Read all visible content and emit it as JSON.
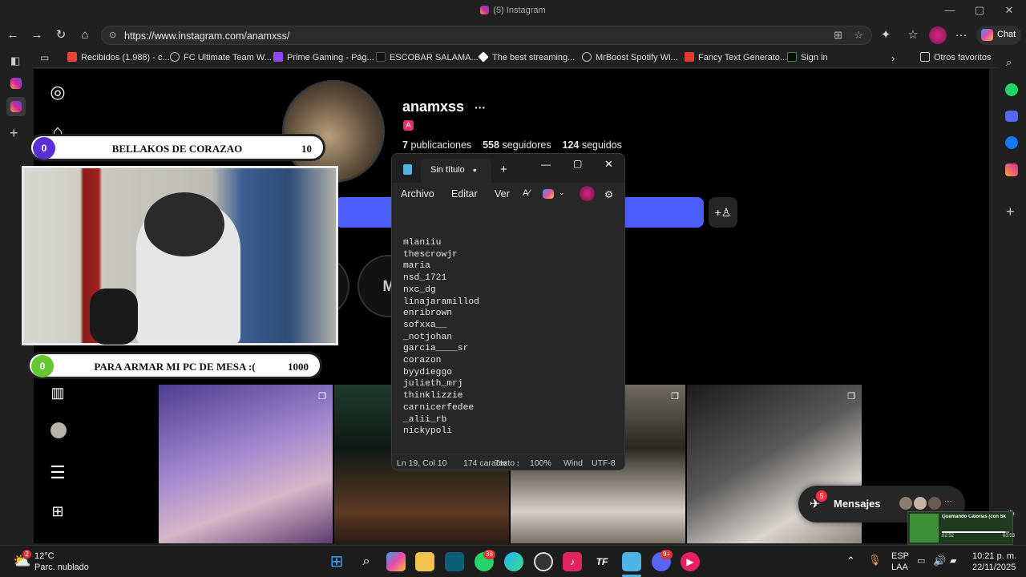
{
  "browser": {
    "title": "(5) Instagram",
    "url": "https://www.instagram.com/anamxss/",
    "chat_label": "Chat",
    "bookmarks": [
      {
        "label": "Recibidos (1.988) - c..."
      },
      {
        "label": "FC Ultimate Team W..."
      },
      {
        "label": "Prime Gaming - Pág..."
      },
      {
        "label": "ESCOBAR SALAMA..."
      },
      {
        "label": "The best streaming..."
      },
      {
        "label": "MrBoost Spotify Wi..."
      },
      {
        "label": "Fancy Text Generato..."
      },
      {
        "label": "Sign in"
      }
    ],
    "other_favorites": "Otros favoritos"
  },
  "profile": {
    "username": "anamxss",
    "badge": "A",
    "posts_count": "7",
    "posts_label": "publicaciones",
    "followers_count": "558",
    "followers_label": "seguidores",
    "following_count": "124",
    "following_label": "seguidos",
    "highlight_text": "M"
  },
  "overlay": {
    "top": {
      "count": "0",
      "label": "BELLAKOS DE CORAZAO",
      "goal": "10"
    },
    "bottom": {
      "count": "0",
      "label": "PARA ARMAR MI PC DE MESA :(",
      "goal": "1000"
    }
  },
  "notepad": {
    "tab_title": "Sin título",
    "menu": {
      "file": "Archivo",
      "edit": "Editar",
      "view": "Ver"
    },
    "lines": [
      "mlaniiu",
      "thescrowjr",
      "maria",
      "nsd_1721",
      "nxc_dg",
      "linajaramillod",
      "enribrown",
      "sofxxa__",
      "_notjohan",
      "garcia____sr",
      "corazon",
      "byydieggo",
      "julieth_mrj",
      "thinklizzie",
      "carnicerfedee",
      "_alii_rb",
      "nickypoli"
    ],
    "status": {
      "position": "Ln 19, Col 10",
      "chars": "174 caracte",
      "type": "Texto s",
      "zoom": "100%",
      "eol": "Wind",
      "encoding": "UTF-8"
    }
  },
  "messages": {
    "label": "Mensajes",
    "badge": "5"
  },
  "mini_player": {
    "title": "Quemando Calorías (con Sk",
    "elapsed": "02:52",
    "total": "03:03"
  },
  "taskbar": {
    "weather_temp": "12°C",
    "weather_desc": "Parc. nublado",
    "weather_badge": "2",
    "whatsapp_badge": "38",
    "discord_badge": "9+",
    "lang": "ESP",
    "lang2": "LAA",
    "time": "10:21 p. m.",
    "date": "22/11/2025"
  },
  "colors": {
    "accent_blue": "#4a5df9",
    "page_bg": "#000000",
    "chrome_bg": "#202020"
  }
}
